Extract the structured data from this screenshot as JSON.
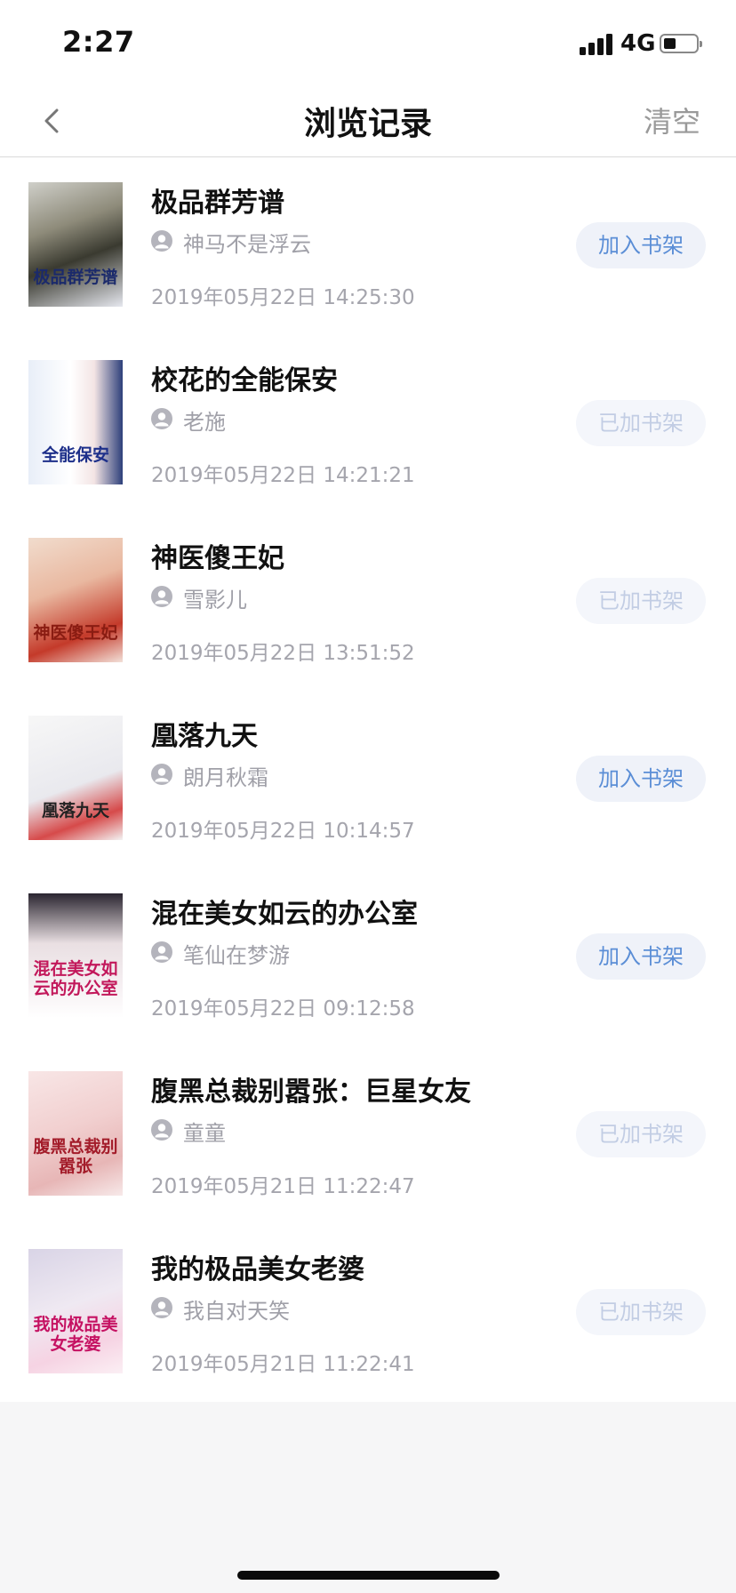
{
  "status_bar": {
    "time": "2:27",
    "network": "4G",
    "battery_level": 0.35
  },
  "nav": {
    "title": "浏览记录",
    "clear_label": "清空"
  },
  "colors": {
    "accent": "#5b8ed6",
    "button_bg": "#eff2f9",
    "muted_text": "#a5a5ad"
  },
  "history": [
    {
      "title": "极品群芳谱",
      "author": "神马不是浮云",
      "time": "2019年05月22日 14:25:30",
      "action": "加入书架",
      "on_shelf": false,
      "cover_text": "极品群芳谱"
    },
    {
      "title": "校花的全能保安",
      "author": "老施",
      "time": "2019年05月22日 14:21:21",
      "action": "已加书架",
      "on_shelf": true,
      "cover_text": "全能保安"
    },
    {
      "title": "神医傻王妃",
      "author": "雪影儿",
      "time": "2019年05月22日 13:51:52",
      "action": "已加书架",
      "on_shelf": true,
      "cover_text": "神医傻王妃"
    },
    {
      "title": "凰落九天",
      "author": "朗月秋霜",
      "time": "2019年05月22日 10:14:57",
      "action": "加入书架",
      "on_shelf": false,
      "cover_text": "凰落九天"
    },
    {
      "title": "混在美女如云的办公室",
      "author": "笔仙在梦游",
      "time": "2019年05月22日 09:12:58",
      "action": "加入书架",
      "on_shelf": false,
      "cover_text": "混在美女如云的办公室"
    },
    {
      "title": "腹黑总裁别嚣张：巨星女友",
      "author": "童童",
      "time": "2019年05月21日 11:22:47",
      "action": "已加书架",
      "on_shelf": true,
      "cover_text": "腹黑总裁别嚣张"
    },
    {
      "title": "我的极品美女老婆",
      "author": "我自对天笑",
      "time": "2019年05月21日 11:22:41",
      "action": "已加书架",
      "on_shelf": true,
      "cover_text": "我的极品美女老婆"
    }
  ]
}
